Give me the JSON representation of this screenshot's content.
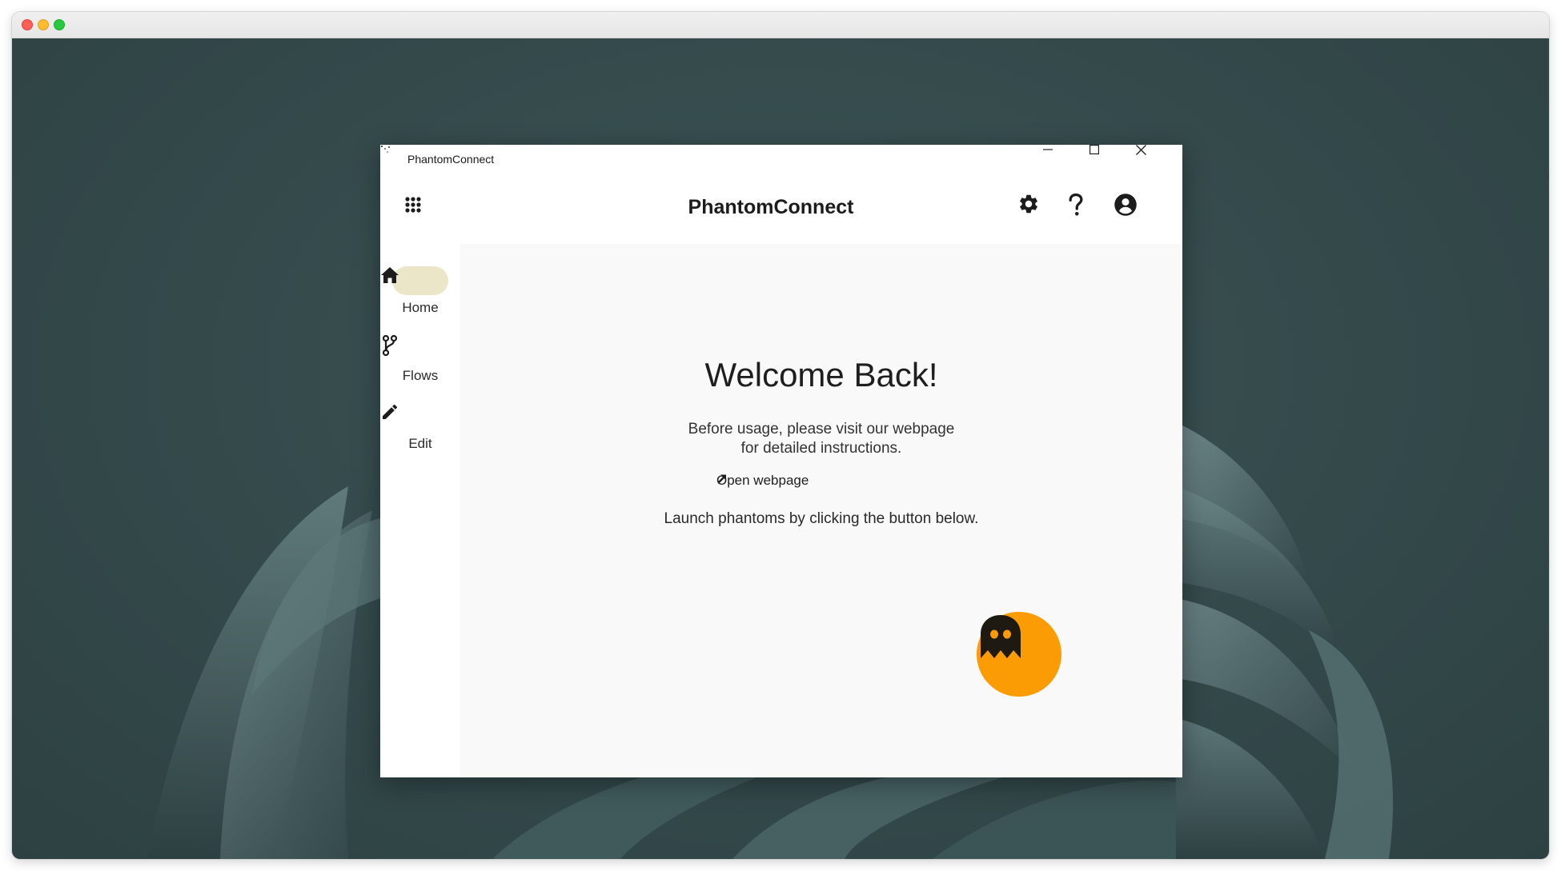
{
  "window": {
    "title": "PhantomConnect",
    "controls": {
      "minimize": "minimize-icon",
      "maximize": "maximize-icon",
      "close": "close-icon"
    }
  },
  "header": {
    "title": "PhantomConnect",
    "menu_icon": "apps-grid-icon",
    "actions": [
      "settings-icon",
      "help-icon",
      "account-icon"
    ]
  },
  "sidebar": {
    "items": [
      {
        "label": "Home",
        "icon": "home-icon",
        "active": true
      },
      {
        "label": "Flows",
        "icon": "flows-branch-icon",
        "active": false
      },
      {
        "label": "Edit",
        "icon": "edit-pencil-icon",
        "active": false
      }
    ]
  },
  "main": {
    "welcome_title": "Welcome Back!",
    "intro_line1": "Before usage, please visit our webpage",
    "intro_line2": "for detailed instructions.",
    "open_webpage_label": "Open webpage",
    "launch_text": "Launch phantoms by clicking the button below.",
    "launch_button_icon": "ghost-icon"
  },
  "colors": {
    "accent_orange": "#fb9c05",
    "active_nav_pill": "#ebe6c7",
    "content_bg": "#f9f9f9",
    "desktop_bg": "#354b4c"
  }
}
